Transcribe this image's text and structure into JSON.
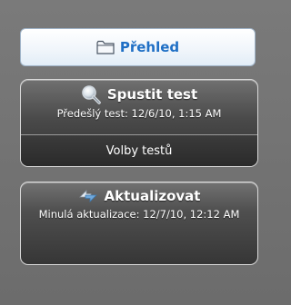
{
  "overview": {
    "label": "Přehled",
    "icon": "folder-icon"
  },
  "scan": {
    "title": "Spustit test",
    "icon": "magnifier-icon",
    "last_scan": "Předešlý test: 12/6/10, 1:15 AM",
    "options_label": "Volby testů"
  },
  "update": {
    "title": "Aktualizovat",
    "icon": "refresh-arrows-icon",
    "last_update": "Minulá aktualizace: 12/7/10, 12:12 AM"
  },
  "colors": {
    "accent": "#1f6fc5",
    "panel_dark": "#323232",
    "background": "#757575"
  }
}
